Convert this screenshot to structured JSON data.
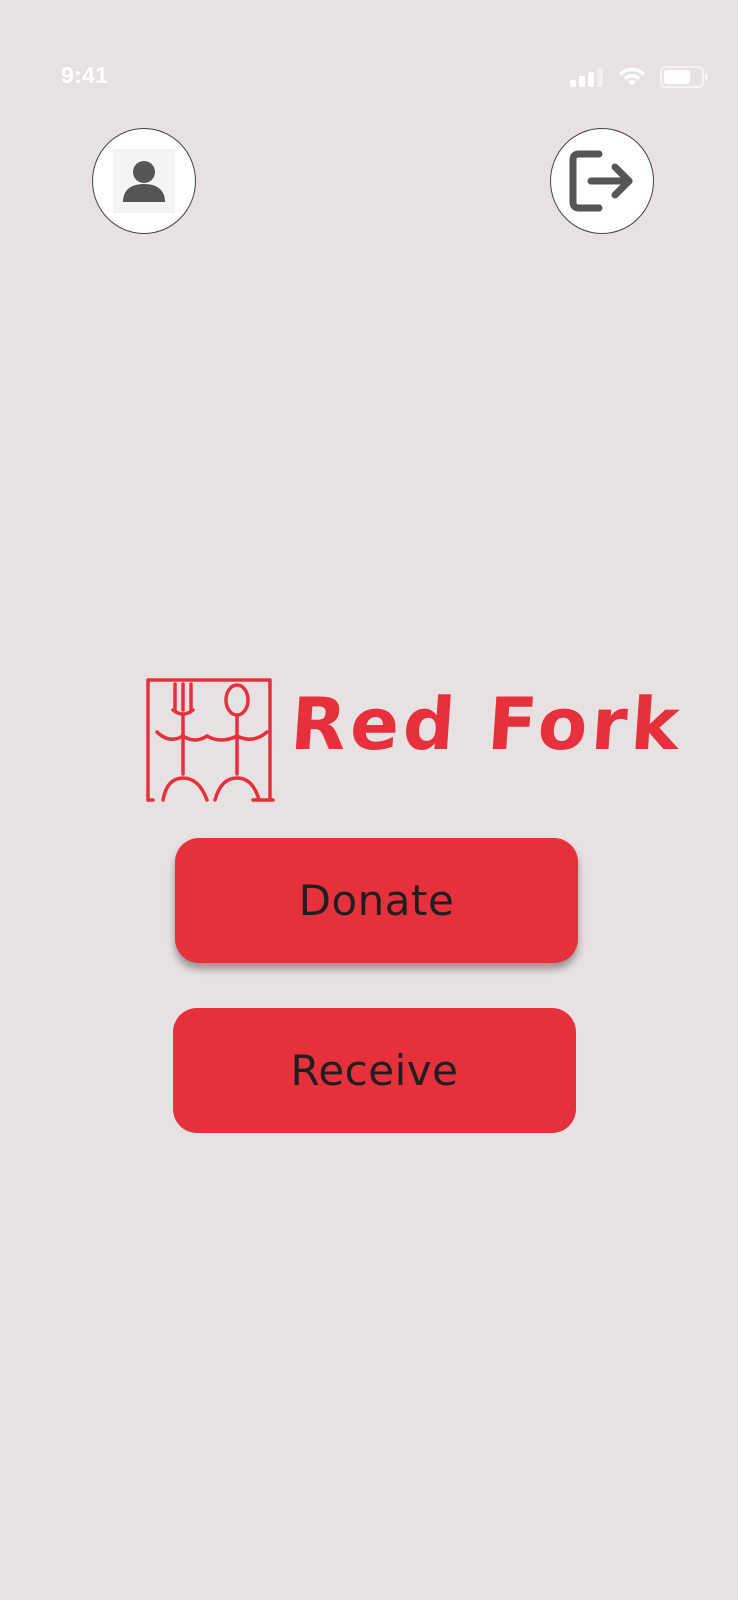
{
  "status_bar": {
    "time": "9:41",
    "icons": [
      "signal-icon",
      "wifi-icon",
      "battery-icon"
    ]
  },
  "header": {
    "profile_icon": "person-icon",
    "logout_icon": "logout-icon"
  },
  "logo": {
    "text": "Red Fork",
    "icon": "fork-spoon-figures-icon"
  },
  "actions": {
    "donate_label": "Donate",
    "receive_label": "Receive"
  },
  "colors": {
    "background": "#e8e1e2",
    "brand_red": "#e6313d",
    "icon_gray": "#555555"
  }
}
